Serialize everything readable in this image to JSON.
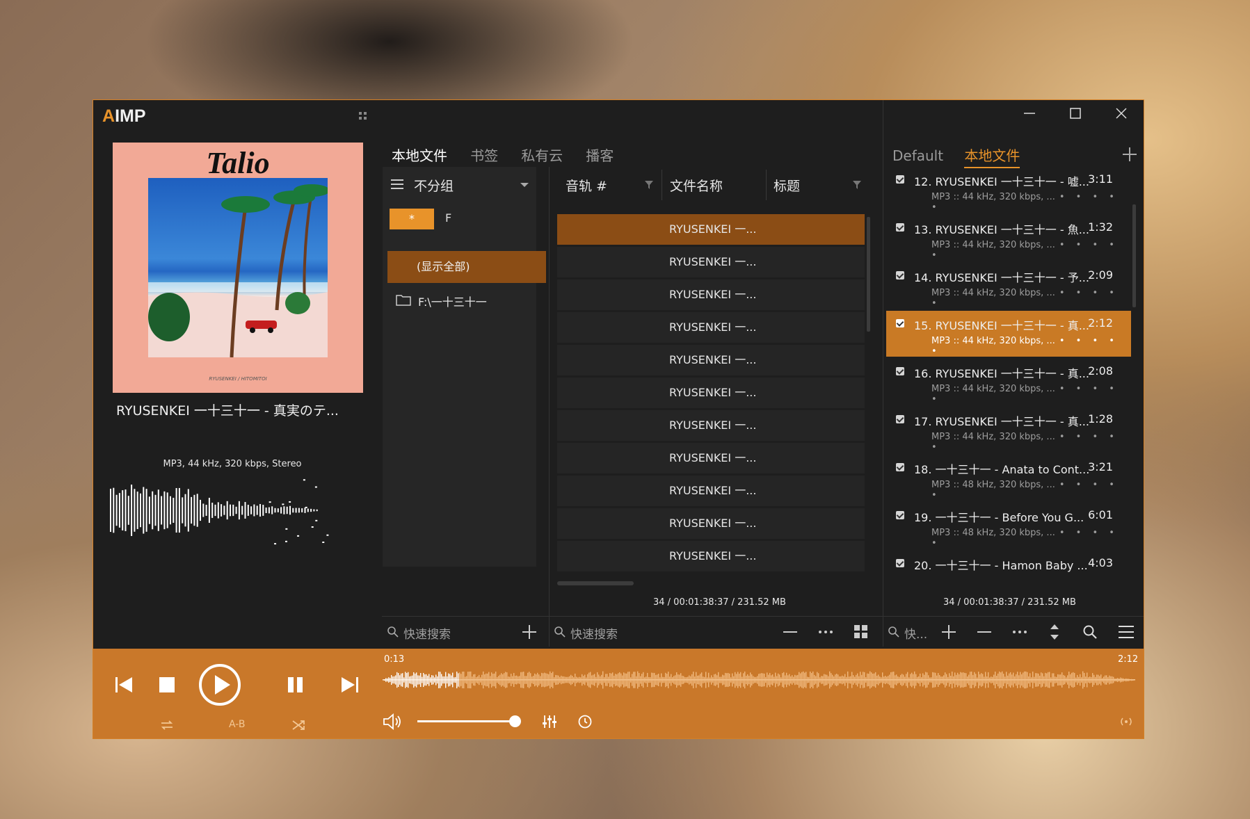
{
  "app": {
    "logo_prefix": "A",
    "logo_rest": "IMP"
  },
  "window_controls": {
    "minimize": "minimize-icon",
    "maximize": "maximize-icon",
    "close": "close-icon"
  },
  "now_playing": {
    "cover_title": "Talio",
    "cover_footer": "RYUSENKEI / HITOMITOI",
    "track_title": "RYUSENKEI 一十三十一 - 真実のテ...",
    "format_info": "MP3, 44 kHz, 320 kbps, Stereo"
  },
  "library": {
    "tabs": [
      "本地文件",
      "书签",
      "私有云",
      "播客"
    ],
    "active_tab": 0,
    "group_label": "不分组",
    "filter_badge": "*",
    "filter_letter": "F",
    "groups": [
      "(显示全部)",
      "F:\\一十三十一"
    ],
    "columns": [
      "音轨 #",
      "文件名称",
      "标题"
    ],
    "rows": [
      "RYUSENKEI 一...",
      "RYUSENKEI 一...",
      "RYUSENKEI 一...",
      "RYUSENKEI 一...",
      "RYUSENKEI 一...",
      "RYUSENKEI 一...",
      "RYUSENKEI 一...",
      "RYUSENKEI 一...",
      "RYUSENKEI 一...",
      "RYUSENKEI 一...",
      "RYUSENKEI 一..."
    ],
    "status": "34 / 00:01:38:37 / 231.52 MB",
    "search_left": "快速搜索",
    "search_mid": "快速搜索"
  },
  "playlist": {
    "tabs": [
      "Default",
      "本地文件"
    ],
    "active_tab": 1,
    "items": [
      {
        "title": "12. RYUSENKEI 一十三十一 - 嘘...",
        "duration": "3:11",
        "info": "MP3 :: 44 kHz, 320 kbps, ..."
      },
      {
        "title": "13. RYUSENKEI 一十三十一 - 魚...",
        "duration": "1:32",
        "info": "MP3 :: 44 kHz, 320 kbps, ..."
      },
      {
        "title": "14. RYUSENKEI 一十三十一 - 予...",
        "duration": "2:09",
        "info": "MP3 :: 44 kHz, 320 kbps, ..."
      },
      {
        "title": "15. RYUSENKEI 一十三十一 - 真...",
        "duration": "2:12",
        "info": "MP3 :: 44 kHz, 320 kbps, ..."
      },
      {
        "title": "16. RYUSENKEI 一十三十一 - 真...",
        "duration": "2:08",
        "info": "MP3 :: 44 kHz, 320 kbps, ..."
      },
      {
        "title": "17. RYUSENKEI 一十三十一 - 真...",
        "duration": "1:28",
        "info": "MP3 :: 44 kHz, 320 kbps, ..."
      },
      {
        "title": "18. 一十三十一 - Anata to Cont...",
        "duration": "3:21",
        "info": "MP3 :: 48 kHz, 320 kbps, ..."
      },
      {
        "title": "19. 一十三十一 - Before You G...",
        "duration": "6:01",
        "info": "MP3 :: 48 kHz, 320 kbps, ..."
      },
      {
        "title": "20. 一十三十一 - Hamon Baby ...",
        "duration": "4:03",
        "info": ""
      }
    ],
    "selected_index": 3,
    "status": "34 / 00:01:38:37 / 231.52 MB",
    "search": "快..."
  },
  "player": {
    "elapsed": "0:13",
    "total": "2:12",
    "progress_fraction": 0.1,
    "volume_fraction": 1.0,
    "ab_label": "A-B"
  },
  "colors": {
    "accent": "#c9782a",
    "selection": "#8b4d15",
    "background": "#1e1e1e"
  }
}
